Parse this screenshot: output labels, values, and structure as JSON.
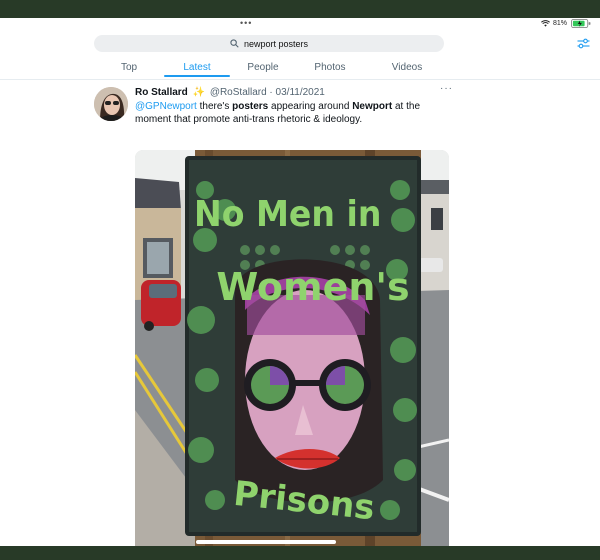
{
  "status": {
    "dots": "•••",
    "battery": "81%"
  },
  "search": {
    "query": "newport posters"
  },
  "tabs": [
    {
      "label": "Top"
    },
    {
      "label": "Latest"
    },
    {
      "label": "People"
    },
    {
      "label": "Photos"
    },
    {
      "label": "Videos"
    }
  ],
  "active_tab": "Latest",
  "tweet": {
    "author_name": "Ro Stallard",
    "sparkle": "✨",
    "handle_date": "@RoStallard · 03/11/2021",
    "more": "···",
    "mention": "@GPNewport",
    "text_1": " there's ",
    "bold_1": "posters",
    "text_2": " appearing around ",
    "bold_2": "Newport",
    "text_3": " at the moment that promote anti-trans rhetoric & ideology."
  },
  "media": {
    "poster_line_1": "No Men in",
    "poster_line_2": "Women's",
    "poster_line_3": "Prisons"
  },
  "colors": {
    "accent": "#1d9bf0",
    "poster_text": "#8fd36d",
    "background_frame": "#283a27"
  }
}
